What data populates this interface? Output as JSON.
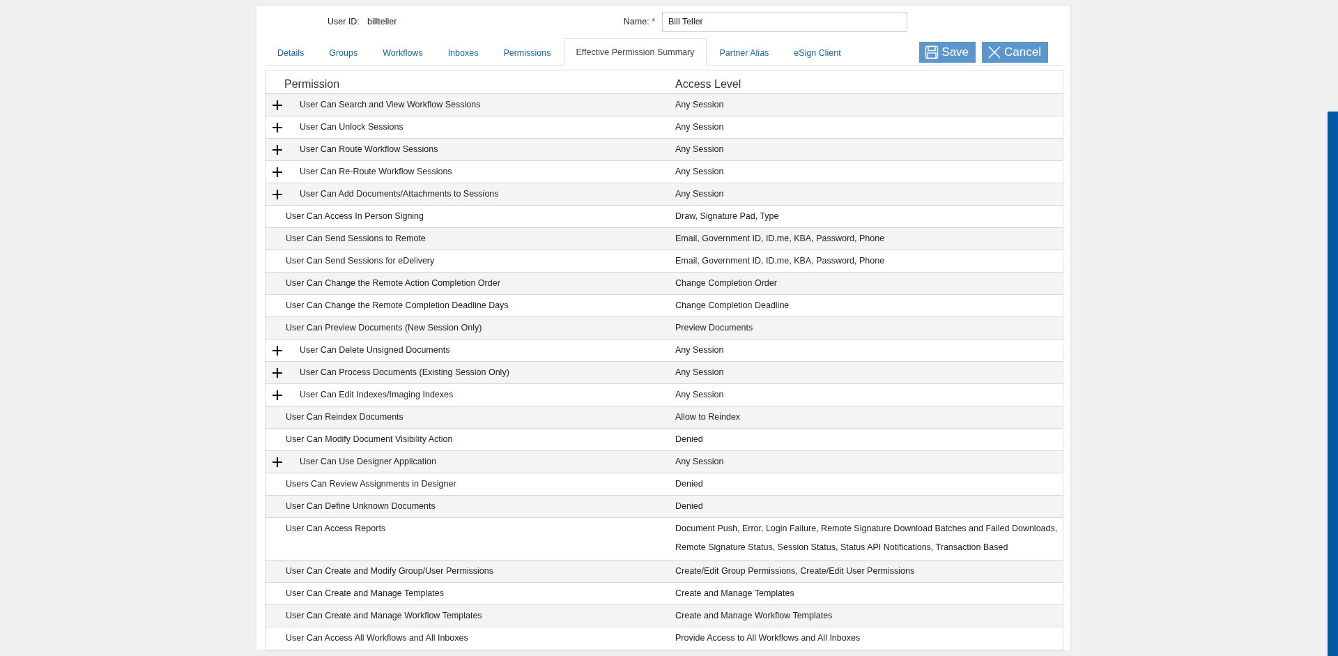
{
  "user": {
    "id_label": "User ID:",
    "id_value": "billteller",
    "name_label": "Name:",
    "required_mark": "*",
    "name_value": "Bill Teller"
  },
  "tabs": [
    {
      "label": "Details",
      "selected": false
    },
    {
      "label": "Groups",
      "selected": false
    },
    {
      "label": "Workflows",
      "selected": false
    },
    {
      "label": "Inboxes",
      "selected": false
    },
    {
      "label": "Permissions",
      "selected": false
    },
    {
      "label": "Effective Permission Summary",
      "selected": true
    },
    {
      "label": "Partner Alias",
      "selected": false
    },
    {
      "label": "eSign Client",
      "selected": false
    }
  ],
  "buttons": [
    {
      "kind": "save",
      "label": "Save"
    },
    {
      "kind": "cancel",
      "label": "Cancel"
    }
  ],
  "table": {
    "columns": [
      "Permission",
      "Access Level"
    ],
    "rows": [
      {
        "kind": "expandable",
        "permission": "User Can Search and View Workflow Sessions",
        "access": [
          "Any Session"
        ]
      },
      {
        "kind": "expandable",
        "permission": "User Can Unlock Sessions",
        "access": [
          "Any Session"
        ]
      },
      {
        "kind": "expandable",
        "permission": "User Can Route Workflow Sessions",
        "access": [
          "Any Session"
        ]
      },
      {
        "kind": "expandable",
        "permission": "User Can Re-Route Workflow Sessions",
        "access": [
          "Any Session"
        ]
      },
      {
        "kind": "expandable",
        "permission": "User Can Add Documents/Attachments to Sessions",
        "access": [
          "Any Session"
        ]
      },
      {
        "kind": "plain",
        "permission": "User Can Access In Person Signing",
        "access": [
          "Draw, Signature Pad, Type"
        ]
      },
      {
        "kind": "plain",
        "permission": "User Can Send Sessions to Remote",
        "access": [
          "Email, Government ID, ID.me, KBA, Password, Phone"
        ]
      },
      {
        "kind": "plain",
        "permission": "User Can Send Sessions for eDelivery",
        "access": [
          "Email, Government ID, ID.me, KBA, Password, Phone"
        ]
      },
      {
        "kind": "plain",
        "permission": "User Can Change the Remote Action Completion Order",
        "access": [
          "Change Completion Order"
        ]
      },
      {
        "kind": "plain",
        "permission": "User Can Change the Remote Completion Deadline Days",
        "access": [
          "Change Completion Deadline"
        ]
      },
      {
        "kind": "plain",
        "permission": "User Can Preview Documents (New Session Only)",
        "access": [
          "Preview Documents"
        ]
      },
      {
        "kind": "expandable",
        "permission": "User Can Delete Unsigned Documents",
        "access": [
          "Any Session"
        ]
      },
      {
        "kind": "expandable",
        "permission": "User Can Process Documents (Existing Session Only)",
        "access": [
          "Any Session"
        ]
      },
      {
        "kind": "expandable",
        "permission": "User Can Edit Indexes/Imaging Indexes",
        "access": [
          "Any Session"
        ]
      },
      {
        "kind": "plain",
        "permission": "User Can Reindex Documents",
        "access": [
          "Allow to Reindex"
        ]
      },
      {
        "kind": "plain",
        "permission": "User Can Modify Document Visibility Action",
        "access": [
          "Denied"
        ]
      },
      {
        "kind": "expandable",
        "permission": "User Can Use Designer Application",
        "access": [
          "Any Session"
        ]
      },
      {
        "kind": "plain",
        "permission": "Users Can Review Assignments in Designer",
        "access": [
          "Denied"
        ]
      },
      {
        "kind": "plain",
        "permission": "User Can Define Unknown Documents",
        "access": [
          "Denied"
        ]
      },
      {
        "kind": "plain",
        "permission": "User Can Access Reports",
        "access": [
          "Document Push, Error, Login Failure, Remote Signature Download Batches and Failed Downloads,",
          "Remote Signature Status, Session Status, Status API Notifications, Transaction Based"
        ]
      },
      {
        "kind": "plain",
        "permission": "User Can Create and Modify Group/User Permissions",
        "access": [
          "Create/Edit Group Permissions, Create/Edit User Permissions"
        ]
      },
      {
        "kind": "plain",
        "permission": "User Can Create and Manage Templates",
        "access": [
          "Create and Manage Templates"
        ]
      },
      {
        "kind": "plain",
        "permission": "User Can Create and Manage Workflow Templates",
        "access": [
          "Create and Manage Workflow Templates"
        ]
      },
      {
        "kind": "plain",
        "permission": "User Can Access All Workflows and All Inboxes",
        "access": [
          "Provide Access to All Workflows and All Inboxes"
        ]
      }
    ]
  }
}
